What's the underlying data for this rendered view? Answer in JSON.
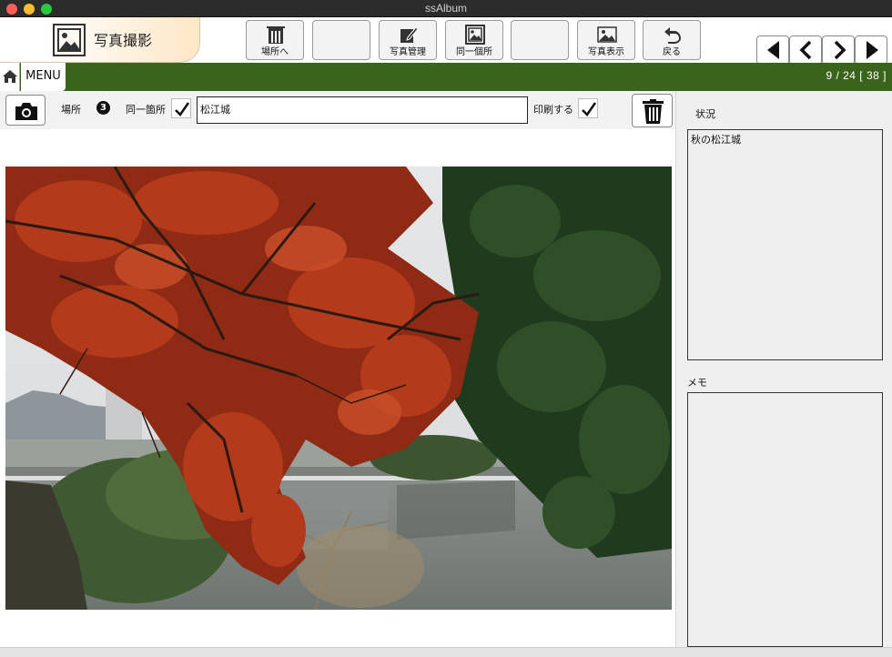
{
  "window": {
    "title": "ssAlbum"
  },
  "app": {
    "section_title": "写真撮影"
  },
  "toolbar": {
    "buttons": [
      {
        "label": "場所へ",
        "icon": "building-icon"
      },
      {
        "label": "",
        "icon": ""
      },
      {
        "label": "写真管理",
        "icon": "edit-icon"
      },
      {
        "label": "同一個所",
        "icon": "photo-stack-icon"
      },
      {
        "label": "",
        "icon": ""
      },
      {
        "label": "写真表示",
        "icon": "image-icon"
      },
      {
        "label": "戻る",
        "icon": "undo-icon"
      }
    ]
  },
  "menu": {
    "label": "MENU"
  },
  "pager": {
    "current": "9",
    "total": "24",
    "count": "38",
    "text": "9 / 24  [ 38 ]"
  },
  "controls": {
    "place_label": "場所",
    "place_number": "3",
    "same_place_label": "同一箇所",
    "same_place_checked": true,
    "place_value": "松江城",
    "print_label": "印刷する",
    "print_checked": true
  },
  "side": {
    "status_label": "状況",
    "status_value": "秋の松江城",
    "memo_label": "メモ",
    "memo_value": ""
  },
  "colors": {
    "green_bar": "#3a641b",
    "tab_gradient_end": "#fde7c6"
  }
}
